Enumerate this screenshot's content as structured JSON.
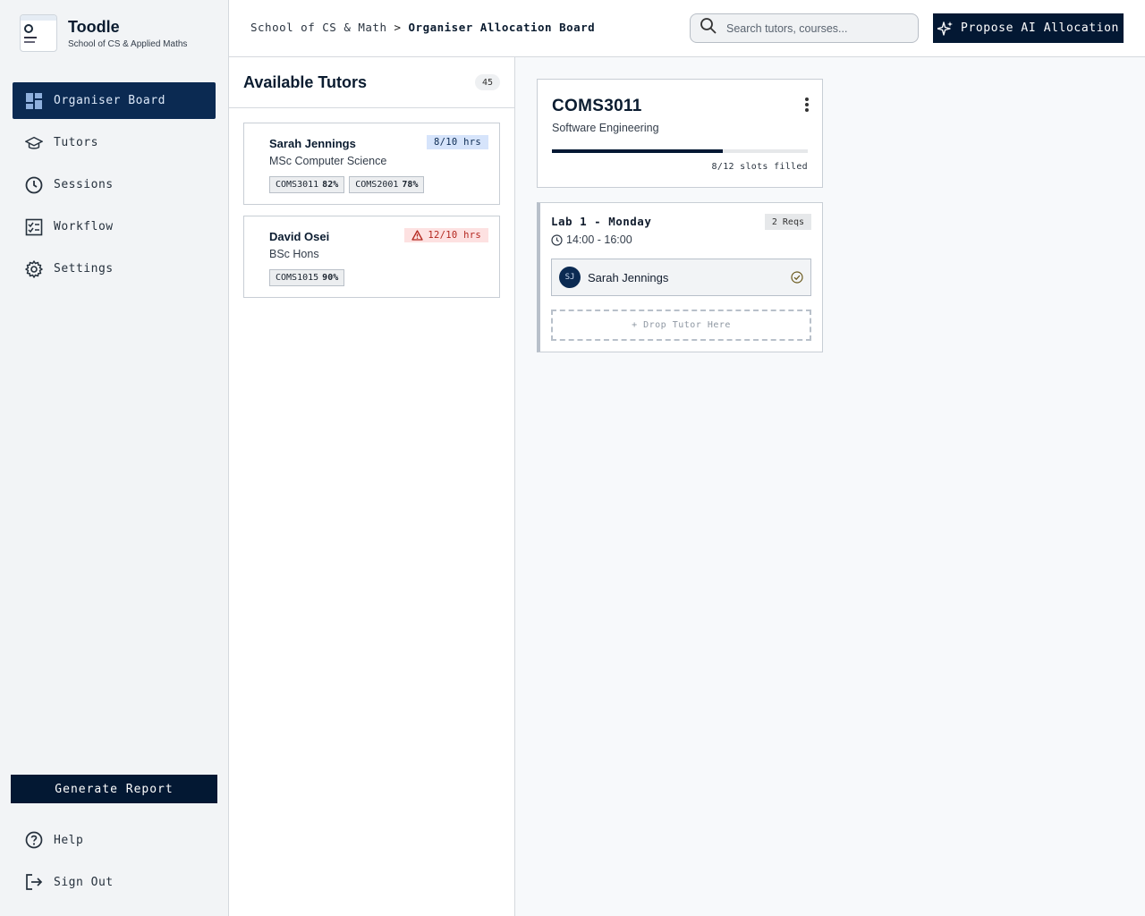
{
  "brand": {
    "name": "Toodle",
    "subtitle": "School of CS & Applied Maths"
  },
  "nav": [
    {
      "label": "Organiser Board",
      "icon": "dashboard-icon",
      "active": true
    },
    {
      "label": "Tutors",
      "icon": "graduation-cap-icon"
    },
    {
      "label": "Sessions",
      "icon": "clock-icon"
    },
    {
      "label": "Workflow",
      "icon": "checklist-icon"
    },
    {
      "label": "Settings",
      "icon": "gear-icon"
    }
  ],
  "sidebar_footer": {
    "report_label": "Generate Report",
    "help_label": "Help",
    "signout_label": "Sign Out"
  },
  "header": {
    "breadcrumb_parent": "School of CS & Math",
    "breadcrumb_separator": ">",
    "breadcrumb_current": "Organiser Allocation Board",
    "search_placeholder": "Search tutors, courses...",
    "ai_button_label": "Propose AI Allocation"
  },
  "tutors_panel": {
    "title": "Available Tutors",
    "count": "45",
    "tutors": [
      {
        "name": "Sarah Jennings",
        "degree": "MSc Computer Science",
        "hours": "8/10 hrs",
        "status": "ok",
        "tags": [
          {
            "course": "COMS3011",
            "score": "82%"
          },
          {
            "course": "COMS2001",
            "score": "78%"
          }
        ]
      },
      {
        "name": "David Osei",
        "degree": "BSc Hons",
        "hours": "12/10 hrs",
        "status": "warn",
        "tags": [
          {
            "course": "COMS1015",
            "score": "90%"
          }
        ]
      }
    ]
  },
  "board": {
    "course": {
      "code": "COMS3011",
      "name": "Software Engineering",
      "slots_filled": 8,
      "slots_total": 12,
      "slots_label": "8/12 slots filled"
    },
    "session": {
      "title": "Lab 1 - Monday",
      "reqs": "2 Reqs",
      "time": "14:00 - 16:00",
      "assigned": {
        "initials": "SJ",
        "name": "Sarah Jennings"
      },
      "dropzone_label": "+ Drop Tutor Here"
    }
  },
  "colors": {
    "primary": "#031833",
    "active_nav": "#0b2a52",
    "warn": "#b3261e",
    "ok_badge": "#d6e4fb"
  }
}
